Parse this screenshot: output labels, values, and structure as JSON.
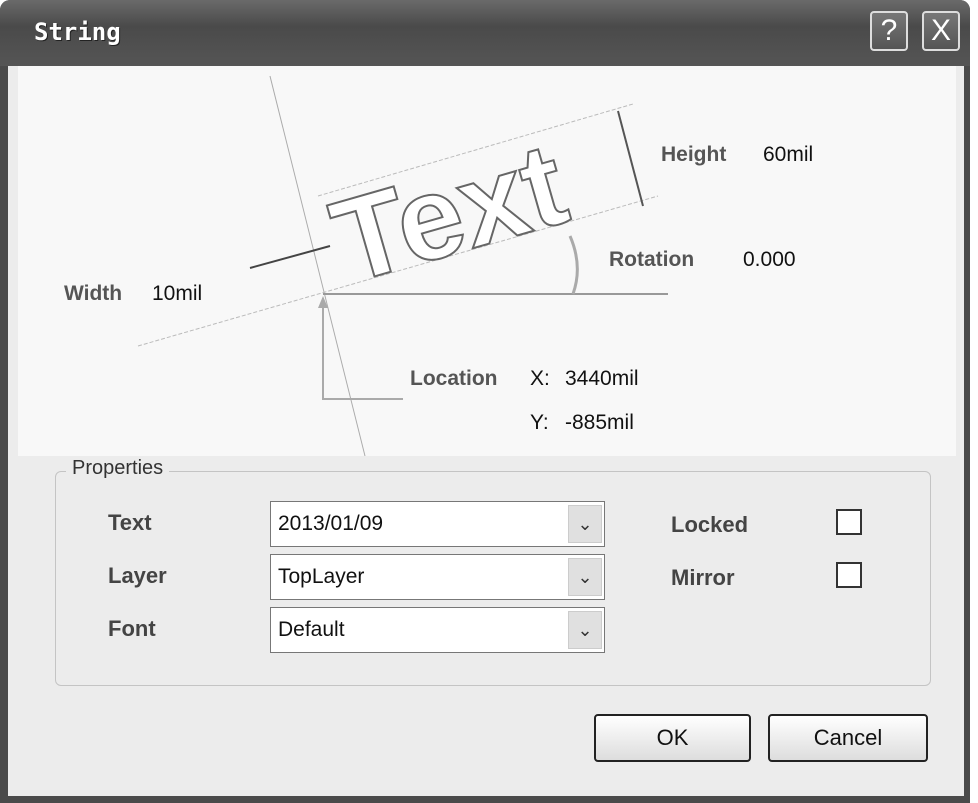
{
  "window": {
    "title": "String",
    "help_icon": "?",
    "close_icon": "X"
  },
  "diagram": {
    "sample_text": "Text",
    "height_label": "Height",
    "height_value": "60mil",
    "rotation_label": "Rotation",
    "rotation_value": "0.000",
    "width_label": "Width",
    "width_value": "10mil",
    "location_label": "Location",
    "x_label": "X:",
    "x_value": "3440mil",
    "y_label": "Y:",
    "y_value": "-885mil"
  },
  "properties": {
    "title": "Properties",
    "text_label": "Text",
    "text_value": "2013/01/09",
    "layer_label": "Layer",
    "layer_value": "TopLayer",
    "font_label": "Font",
    "font_value": "Default",
    "locked_label": "Locked",
    "locked": false,
    "mirror_label": "Mirror",
    "mirror": false
  },
  "buttons": {
    "ok": "OK",
    "cancel": "Cancel"
  }
}
